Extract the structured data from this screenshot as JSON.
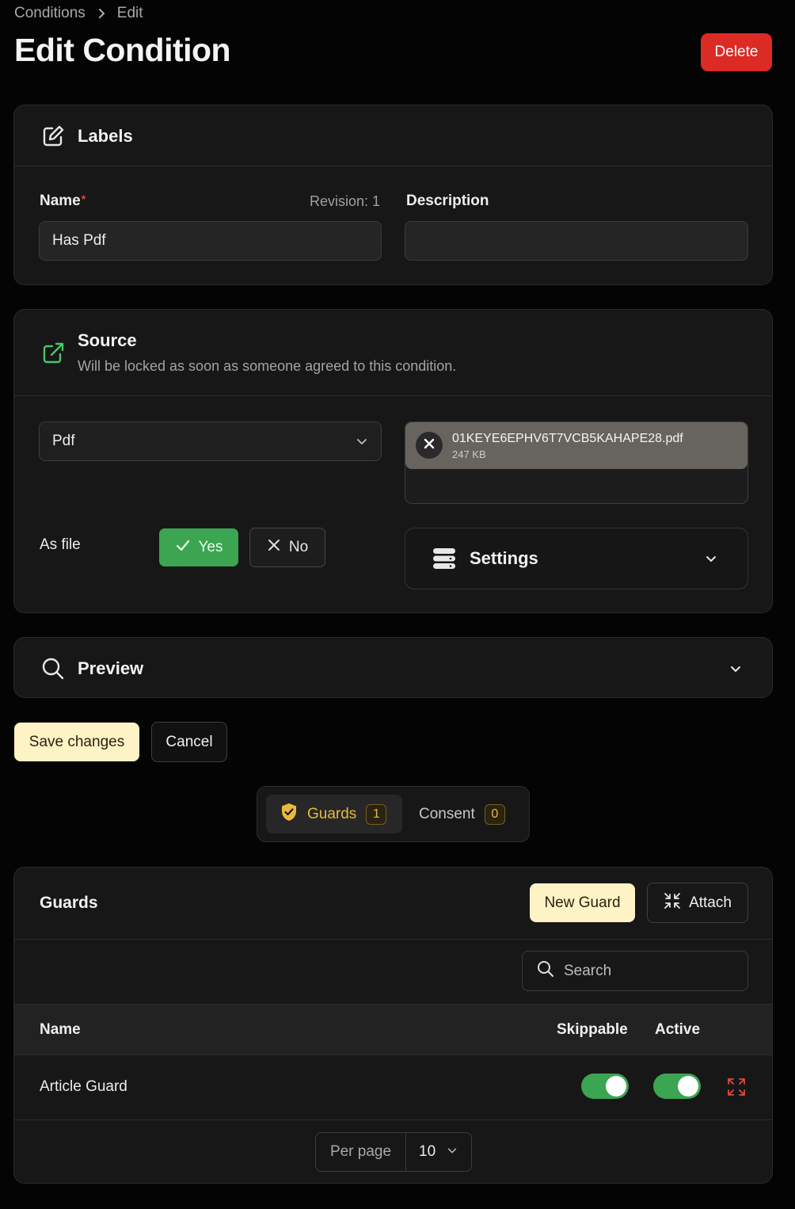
{
  "breadcrumb": {
    "parent": "Conditions",
    "current": "Edit"
  },
  "page_title": "Edit Condition",
  "delete_label": "Delete",
  "labels_section": {
    "title": "Labels",
    "name_label": "Name",
    "required_mark": "*",
    "revision": "Revision: 1",
    "name_value": "Has Pdf",
    "description_label": "Description",
    "description_value": ""
  },
  "source_section": {
    "title": "Source",
    "subtitle": "Will be locked as soon as someone agreed to this condition.",
    "type_selected": "Pdf",
    "file_name": "01KEYE6EPHV6T7VCB5KAHAPE28.pdf",
    "file_size": "247 KB",
    "as_file_label": "As file",
    "yes_label": "Yes",
    "no_label": "No",
    "settings_label": "Settings"
  },
  "preview_section": {
    "title": "Preview"
  },
  "form_actions": {
    "save_label": "Save changes",
    "cancel_label": "Cancel"
  },
  "relation_tabs": [
    {
      "label": "Guards",
      "count": "1"
    },
    {
      "label": "Consent",
      "count": "0"
    }
  ],
  "guards_table": {
    "title": "Guards",
    "new_label": "New Guard",
    "attach_label": "Attach",
    "search_placeholder": "Search",
    "columns": {
      "name": "Name",
      "skippable": "Skippable",
      "active": "Active"
    },
    "rows": [
      {
        "name": "Article Guard",
        "skippable": true,
        "active": true
      }
    ],
    "per_page_label": "Per page",
    "per_page_value": "10"
  },
  "colors": {
    "danger": "#dc2a24",
    "success": "#3ba552",
    "accent": "#e9b93a",
    "cream": "#fef3c5"
  }
}
